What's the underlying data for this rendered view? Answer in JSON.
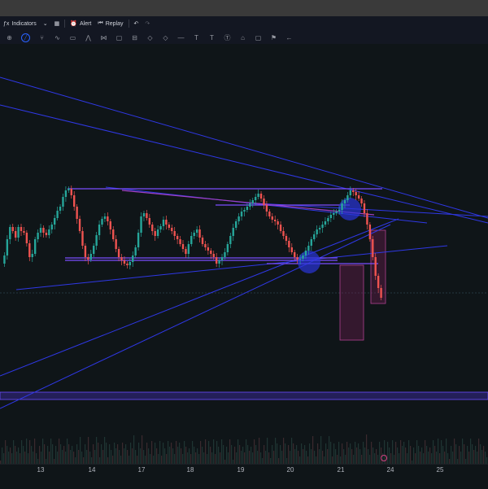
{
  "toolbar": {
    "indicators_label": "Indicators",
    "alert_label": "Alert",
    "replay_label": "Replay"
  },
  "drawing_tools": [
    "cursor-icon",
    "trend-line-icon",
    "pitchfork-icon",
    "brush-icon",
    "text-icon",
    "pattern-icon",
    "prediction-icon",
    "shapes-icon",
    "measure-icon",
    "zoom-icon",
    "magnet-icon",
    "lock-icon",
    "text-tool-icon",
    "text-tool-2-icon",
    "note-icon",
    "price-note-icon",
    "callout-icon",
    "flag-icon",
    "arrow-icon"
  ],
  "time_axis": {
    "ticks": [
      "13",
      "14",
      "17",
      "18",
      "19",
      "20",
      "21",
      "24",
      "25"
    ]
  },
  "colors": {
    "background": "#0f1518",
    "bull_candle": "#26a69a",
    "bear_candle": "#ef5350",
    "trendline": "#2f38e6",
    "purple_line": "#7b4dff",
    "zone_fill": "#a0306a"
  },
  "chart_data": {
    "type": "candlestick",
    "instrument": "",
    "x": [
      "13",
      "14",
      "17",
      "18",
      "19",
      "20",
      "21",
      "24",
      "25"
    ],
    "annotations": [
      "horizontal range lines",
      "trendlines",
      "two rectangle zones",
      "volume bars"
    ]
  }
}
